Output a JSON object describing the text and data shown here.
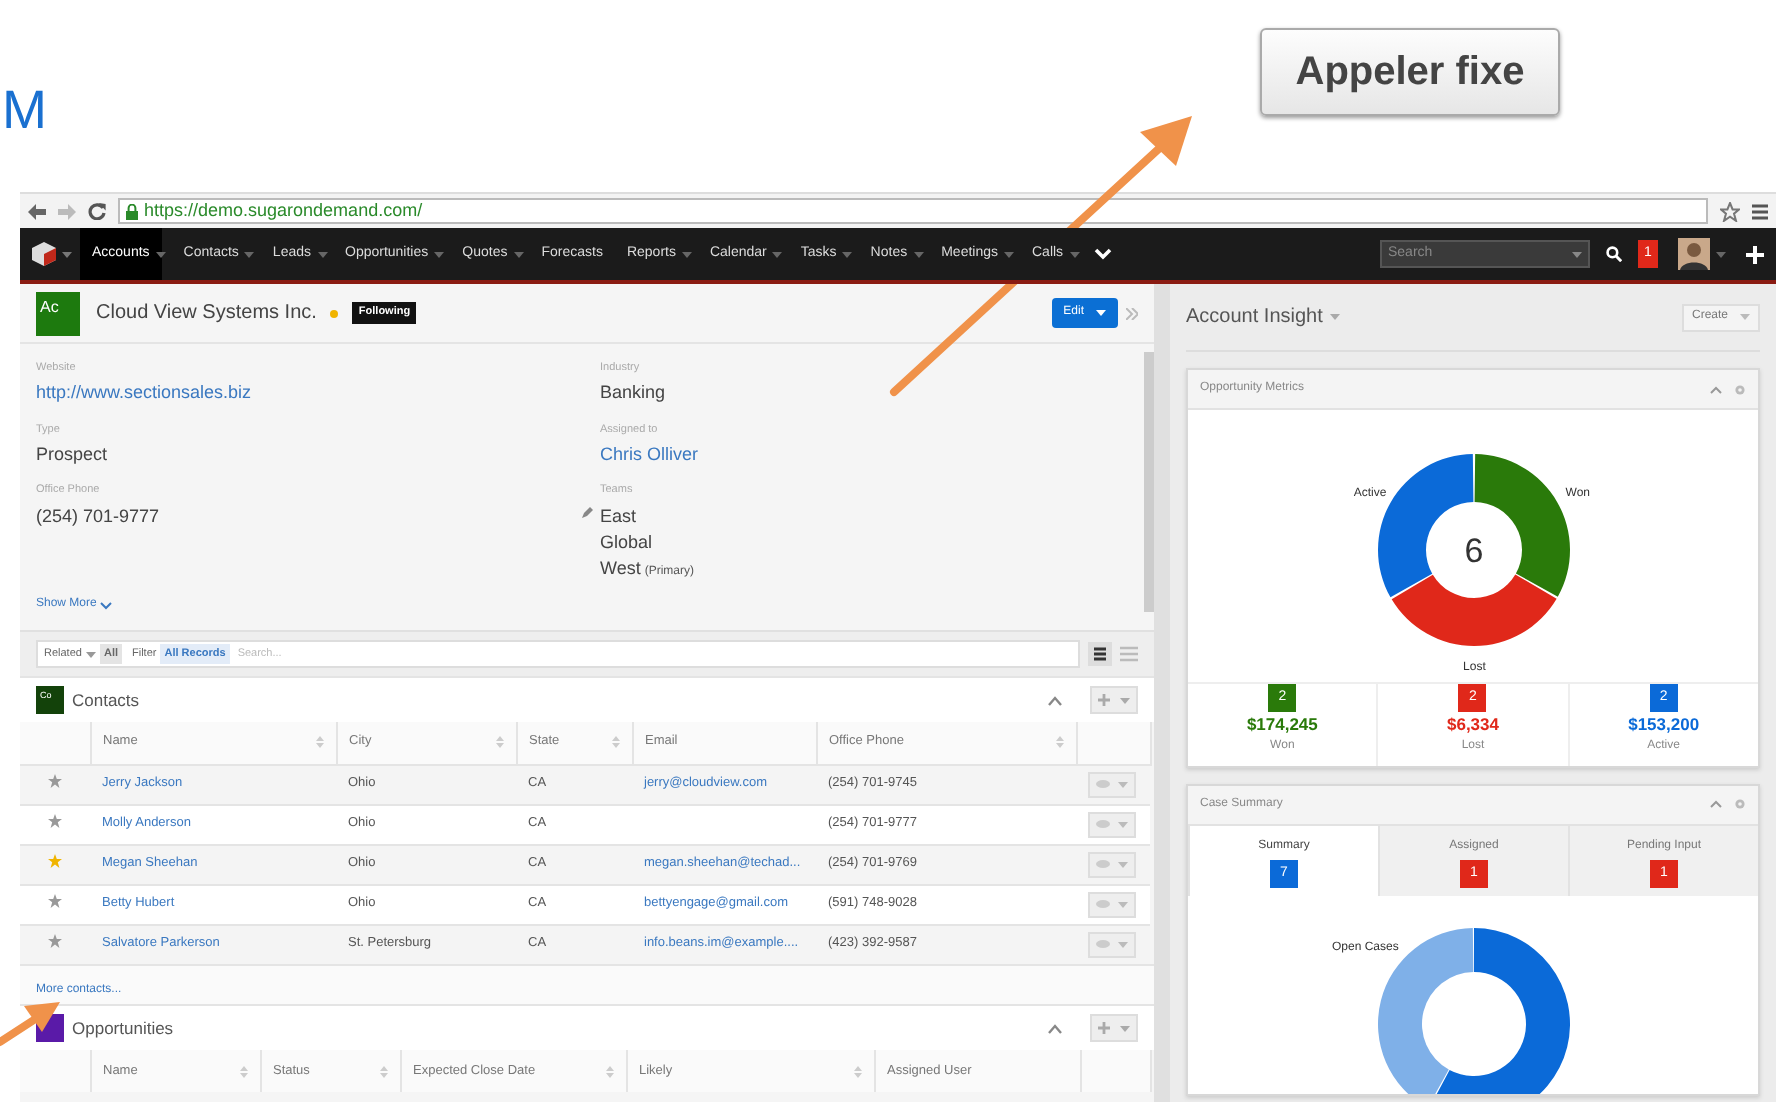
{
  "slide_title": "M",
  "call_button": "Appeler fixe",
  "browser": {
    "url": "https://demo.sugarondemand.com/"
  },
  "nav": {
    "items": [
      {
        "label": "Accounts",
        "selected": true,
        "dropdown": true
      },
      {
        "label": "Contacts",
        "selected": false,
        "dropdown": true
      },
      {
        "label": "Leads",
        "selected": false,
        "dropdown": true
      },
      {
        "label": "Opportunities",
        "selected": false,
        "dropdown": true
      },
      {
        "label": "Quotes",
        "selected": false,
        "dropdown": true
      },
      {
        "label": "Forecasts",
        "selected": false,
        "dropdown": false
      },
      {
        "label": "Reports",
        "selected": false,
        "dropdown": true
      },
      {
        "label": "Calendar",
        "selected": false,
        "dropdown": true
      },
      {
        "label": "Tasks",
        "selected": false,
        "dropdown": true
      },
      {
        "label": "Notes",
        "selected": false,
        "dropdown": true
      },
      {
        "label": "Meetings",
        "selected": false,
        "dropdown": true
      },
      {
        "label": "Calls",
        "selected": false,
        "dropdown": true
      }
    ],
    "search_placeholder": "Search",
    "notifications": "1"
  },
  "record": {
    "badge": "Ac",
    "name": "Cloud View Systems Inc.",
    "favorite": true,
    "following": "Following",
    "edit": "Edit",
    "fields": [
      {
        "label": "Website",
        "values": [
          "http://www.sectionsales.biz"
        ],
        "kind": "link"
      },
      {
        "label": "Industry",
        "values": [
          "Banking"
        ],
        "kind": "text"
      },
      {
        "label": "Type",
        "values": [
          "Prospect"
        ],
        "kind": "text"
      },
      {
        "label": "Assigned to",
        "values": [
          "Chris Olliver"
        ],
        "kind": "link"
      },
      {
        "label": "Office Phone",
        "values": [
          "(254) 701-9777"
        ],
        "kind": "text"
      },
      {
        "label": "Teams",
        "values": [
          "East",
          "Global",
          "West"
        ],
        "kind": "teams",
        "primary_note": "(Primary)"
      }
    ],
    "show_more": "Show More"
  },
  "filter": {
    "related": "Related",
    "all": "All",
    "filter": "Filter",
    "records": "All Records",
    "placeholder": "Search..."
  },
  "contacts": {
    "badge": "Co",
    "title": "Contacts",
    "columns": [
      {
        "label": "Name",
        "sortable": true
      },
      {
        "label": "City",
        "sortable": true
      },
      {
        "label": "State",
        "sortable": true
      },
      {
        "label": "Email",
        "sortable": false
      },
      {
        "label": "Office Phone",
        "sortable": true
      }
    ],
    "rows": [
      {
        "favorite": false,
        "cells": [
          "Jerry Jackson",
          "Ohio",
          "CA",
          "jerry@cloudview.com",
          "(254) 701-9745"
        ]
      },
      {
        "favorite": false,
        "cells": [
          "Molly Anderson",
          "Ohio",
          "CA",
          "",
          "(254) 701-9777"
        ]
      },
      {
        "favorite": true,
        "cells": [
          "Megan Sheehan",
          "Ohio",
          "CA",
          "megan.sheehan@techad...",
          "(254) 701-9769"
        ]
      },
      {
        "favorite": false,
        "cells": [
          "Betty Hubert",
          "Ohio",
          "CA",
          "bettyengage@gmail.com",
          "(591) 748-9028"
        ]
      },
      {
        "favorite": false,
        "cells": [
          "Salvatore Parkerson",
          "St. Petersburg",
          "CA",
          "info.beans.im@example....",
          "(423) 392-9587"
        ]
      }
    ],
    "more": "More contacts..."
  },
  "opportunities": {
    "title": "Opportunities",
    "columns": [
      {
        "label": "Name",
        "sortable": true
      },
      {
        "label": "Status",
        "sortable": true
      },
      {
        "label": "Expected Close Date",
        "sortable": true
      },
      {
        "label": "Likely",
        "sortable": true
      },
      {
        "label": "Assigned User",
        "sortable": false
      }
    ]
  },
  "insight": {
    "title": "Account Insight",
    "create": "Create"
  },
  "metrics": {
    "title": "Opportunity Metrics",
    "total": "6",
    "chart_data": {
      "type": "donut",
      "categories": [
        "Won",
        "Lost",
        "Active"
      ],
      "values": [
        33.3,
        33.3,
        33.4
      ]
    },
    "stats": [
      {
        "count": "2",
        "amount": "$174,245",
        "label": "Won",
        "color": "#2a7a0a"
      },
      {
        "count": "2",
        "amount": "$6,334",
        "label": "Lost",
        "color": "#e0281a"
      },
      {
        "count": "2",
        "amount": "$153,200",
        "label": "Active",
        "color": "#0b6ad8"
      }
    ]
  },
  "cases": {
    "title": "Case Summary",
    "tabs": [
      {
        "label": "Summary",
        "count": "7",
        "color": "#0b6ad8",
        "selected": true
      },
      {
        "label": "Assigned",
        "count": "1",
        "color": "#e0281a",
        "selected": false
      },
      {
        "label": "Pending Input",
        "count": "1",
        "color": "#e0281a",
        "selected": false
      }
    ],
    "donut_label": "Open Cases"
  }
}
